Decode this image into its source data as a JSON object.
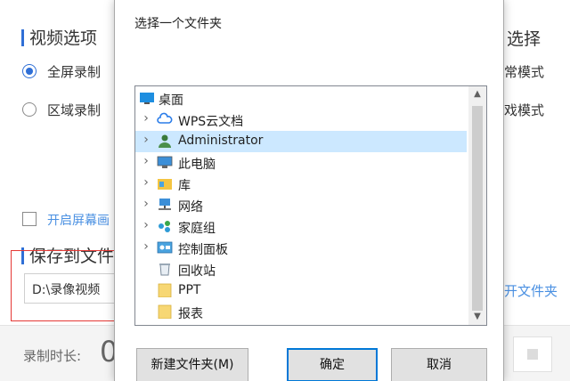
{
  "background": {
    "video_options_title": "视频选项",
    "right_title": "选择",
    "mode_fullscreen": "全屏录制",
    "mode_region": "区域录制",
    "right_opt1": "常模式",
    "right_opt2": "戏模式",
    "checkbox_label": "开启屏幕画",
    "save_title": "保存到文件",
    "save_path": "D:\\录像视频",
    "open_folder_link": "开文件夹",
    "duration_label": "录制时长:",
    "duration_value": "0"
  },
  "dialog": {
    "title": "选择一个文件夹",
    "tree": [
      {
        "label": "桌面",
        "icon": "desktop-icon",
        "chevron": ""
      },
      {
        "label": "WPS云文档",
        "icon": "cloud-icon",
        "chevron": "›"
      },
      {
        "label": "Administrator",
        "icon": "user-icon",
        "chevron": "›",
        "selected": true
      },
      {
        "label": "此电脑",
        "icon": "computer-icon",
        "chevron": "›"
      },
      {
        "label": "库",
        "icon": "library-icon",
        "chevron": "›"
      },
      {
        "label": "网络",
        "icon": "network-icon",
        "chevron": "›"
      },
      {
        "label": "家庭组",
        "icon": "homegroup-icon",
        "chevron": "›"
      },
      {
        "label": "控制面板",
        "icon": "control-panel-icon",
        "chevron": "›"
      },
      {
        "label": "回收站",
        "icon": "recycle-bin-icon",
        "chevron": ""
      },
      {
        "label": "PPT",
        "icon": "folder-icon",
        "chevron": ""
      },
      {
        "label": "报表",
        "icon": "folder-icon",
        "chevron": ""
      }
    ],
    "buttons": {
      "new_folder": "新建文件夹(M)",
      "ok": "确定",
      "cancel": "取消"
    }
  },
  "colors": {
    "accent": "#2f6fd6",
    "link": "#4a90e2",
    "highlight_box": "#e53935",
    "selection": "#cce8ff",
    "primary_button_border": "#0078d7"
  }
}
